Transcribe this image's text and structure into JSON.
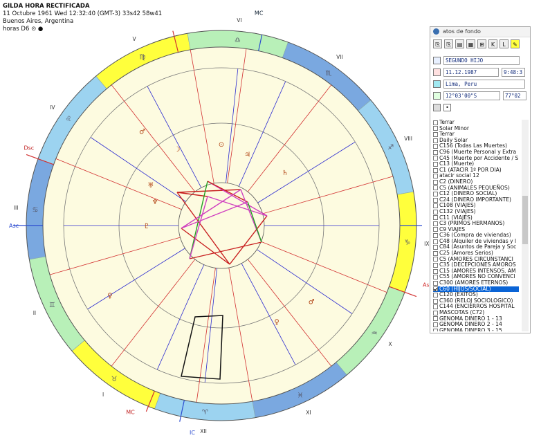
{
  "chart_header": {
    "name": "GILDA HORA RECTIFICADA",
    "date_line": "11 Octubre 1961  Wed  12:32:40 (GMT-3) 33s42  58w41",
    "place": "Buenos Aires, Argentina",
    "system": "horas D6"
  },
  "angles": {
    "mc": "MC",
    "asc": "Asc",
    "dsc": "Dsc",
    "ic": "IC",
    "mc_lower": "MC",
    "asc_right": "Asc",
    "ic_lower": "IC",
    "dsc_lower": "Dsc"
  },
  "house_numbers": [
    "XI",
    "XII",
    "I",
    "II",
    "III",
    "IV",
    "V",
    "VI",
    "VII",
    "VIII",
    "IX",
    "X"
  ],
  "outer_houses": [
    "V",
    "VI",
    "VII",
    "VIII",
    "IX",
    "X",
    "XI",
    "XII",
    "I",
    "II",
    "III",
    "IV"
  ],
  "zodiac_signs": [
    "♌",
    "♍",
    "♎",
    "♏",
    "♐",
    "♑",
    "♒",
    "♓",
    "♈",
    "♉",
    "♊",
    "♋"
  ],
  "zodiac_colors": [
    "#9cd3f0",
    "#ffff3c",
    "#b8f0b8",
    "#7aa8e0"
  ],
  "panel": {
    "title": "atos de fondo",
    "name": "SEGUNDO HIJO",
    "date": "11.12.1987",
    "time": "9:48:3",
    "place": "Lima, Peru",
    "lat": "12°03'00\"S",
    "lon": "77°02",
    "toolbar": [
      "⎘",
      "⎘",
      "▤",
      "▦",
      "⊞",
      "K",
      "L",
      "✎"
    ],
    "list": [
      "Terrar",
      "Solar Minor",
      "Terrar",
      "Daily Solar",
      "C156 (Todas Las Muertes)",
      "C96 (Muerte Personal y Extra",
      "C45 (Muerte por Accidente / S",
      "C13 (Muerte)",
      "C1 (ATACIR 1º POR DIA)",
      "atacir social 12",
      "C2 (DINERO)",
      "C5 (ANIMALES PEQUEÑOS)",
      "C12 (DINERO SOCIAL)",
      "C24 (DINERO IMPORTANTE)",
      "C108 (VIAJES)",
      "C132 (VIAJES)",
      "C11 (VIAJES)",
      "C3 (PRIMOS HERMANOS)",
      "C9 VIAJES",
      "C36 (Compra de viviendas)",
      "C48 (Alquiler de viviendas y l",
      "C84 (Asuntos de Pareja y Soc",
      "C25 (Amores Serios)",
      "C5 (AMORES CIRCUNSTANCI",
      "C35 (DECEPCIONES AMOROS",
      "C15 (AMORES INTENSOS, AM",
      "C55 (AMORES NO CONVENCI",
      "C300 (AMORES ETERNOS)",
      "C60 (HIJOS/SOCIAL)",
      "C120 (EXITOS)",
      "C360 (RELOJ SOCIOLOGICO)",
      "C144 (ENCIERROS HOSPITAL",
      "MASCOTAS (C72)",
      "GENOMA DINERO 1 - 13",
      "GENOMA DINERO 2 - 14",
      "GENOMA DINERO 3 - 15"
    ],
    "selected_index": 28
  }
}
